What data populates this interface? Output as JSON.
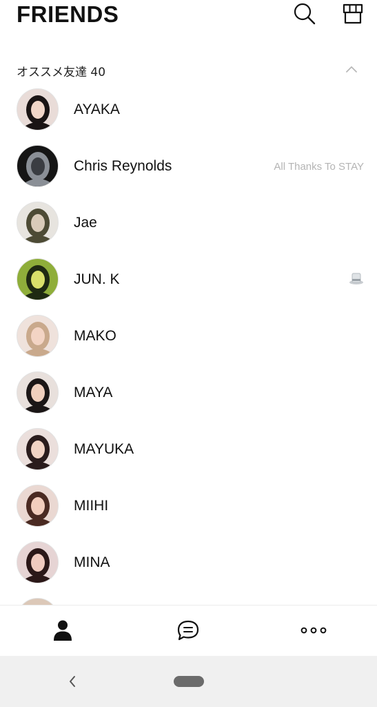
{
  "header": {
    "title": "FRIENDS",
    "search_icon": "search-icon",
    "shop_icon": "shop-icon"
  },
  "section": {
    "label": "オススメ友達 40",
    "collapse_icon": "chevron-up-icon"
  },
  "friends": [
    {
      "name": "AYAKA",
      "status": "",
      "avatar": {
        "bg": "#e9dcd8",
        "accent": "#1a1414",
        "skin": "#f1d6c8"
      }
    },
    {
      "name": "Chris Reynolds",
      "status": "All Thanks To STAY",
      "avatar": {
        "bg": "#151515",
        "accent": "#8a8f96",
        "skin": "#3a3d42"
      }
    },
    {
      "name": "Jae",
      "status": "",
      "avatar": {
        "bg": "#e7e4df",
        "accent": "#4d4b35",
        "skin": "#d9cbb9"
      }
    },
    {
      "name": "JUN. K",
      "status": "",
      "badge": "top-hat-icon",
      "avatar": {
        "bg": "#8fae3a",
        "accent": "#1f2a12",
        "skin": "#d9e06a"
      }
    },
    {
      "name": "MAKO",
      "status": "",
      "avatar": {
        "bg": "#efe2dc",
        "accent": "#c9a98c",
        "skin": "#f3d4c4"
      }
    },
    {
      "name": "MAYA",
      "status": "",
      "avatar": {
        "bg": "#e8e0dc",
        "accent": "#1b1616",
        "skin": "#efcfbd"
      }
    },
    {
      "name": "MAYUKA",
      "status": "",
      "avatar": {
        "bg": "#ebdfdc",
        "accent": "#2a1c1c",
        "skin": "#f1d3c4"
      }
    },
    {
      "name": "MIIHI",
      "status": "",
      "avatar": {
        "bg": "#ead8d2",
        "accent": "#4a2a22",
        "skin": "#f2cdbd"
      }
    },
    {
      "name": "MINA",
      "status": "",
      "avatar": {
        "bg": "#e6d4d4",
        "accent": "#2b1818",
        "skin": "#f0cbbf"
      }
    },
    {
      "name": "",
      "status": "",
      "avatar": {
        "bg": "#dcc8b8",
        "accent": "#1a1010",
        "skin": "#dcc8b8"
      }
    }
  ],
  "tabs": [
    {
      "id": "friends",
      "icon": "person-icon",
      "active": true
    },
    {
      "id": "chats",
      "icon": "chat-bubble-icon",
      "active": false
    },
    {
      "id": "more",
      "icon": "more-dots-icon",
      "active": false
    }
  ],
  "system_nav": {
    "back_icon": "back-chevron-icon",
    "home_icon": "home-pill-icon"
  },
  "colors": {
    "text": "#111111",
    "muted": "#b4b4b4",
    "divider": "#ececec",
    "navbar": "#f0f0f0"
  }
}
